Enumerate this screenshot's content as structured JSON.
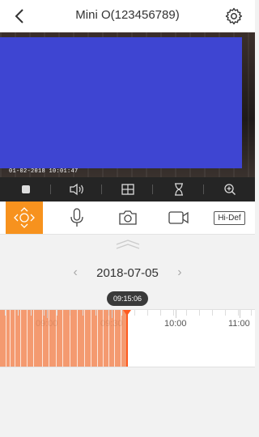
{
  "header": {
    "title": "Mini O(123456789)"
  },
  "video": {
    "timestamp": "01-02-2018 10:01:47",
    "overlay_color": "#3e45d2"
  },
  "controls": {
    "items": [
      "stop-icon",
      "volume-icon",
      "split-view-icon",
      "hourglass-icon",
      "zoom-in-icon"
    ]
  },
  "toolbar": {
    "hidef_label": "Hi-Def",
    "accent": "#f7921e"
  },
  "playback": {
    "date": "2018-07-05",
    "prev": "‹",
    "next": "›",
    "current_time": "09:15:06"
  },
  "timeline": {
    "hours": [
      {
        "label": "09:00",
        "faded": true
      },
      {
        "label": "09:30",
        "faded": true
      },
      {
        "label": "10:00",
        "faded": false
      },
      {
        "label": "11:00",
        "faded": false
      }
    ],
    "record_color": "#f49a70",
    "cursor_color": "#ff5a1f"
  }
}
